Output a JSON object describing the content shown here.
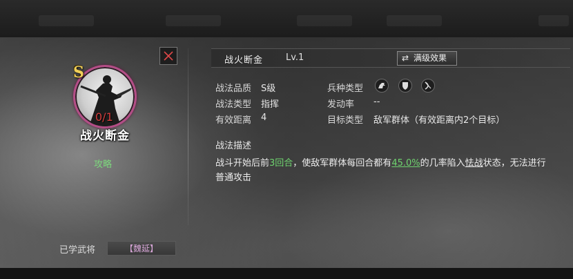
{
  "skill": {
    "grade_badge": "S",
    "level_count": "0/1",
    "name": "战火断金",
    "level": "Lv.1",
    "guide_link": "攻略",
    "max_level_button": "满级效果",
    "max_level_icon": "swap-arrows-icon"
  },
  "attributes": {
    "quality_label": "战法品质",
    "quality_value": "S级",
    "type_label": "战法类型",
    "type_value": "指挥",
    "range_label": "有效距离",
    "range_value": "4",
    "troop_label": "兵种类型",
    "troop_icons": [
      "cavalry-icon",
      "shield-icon",
      "bow-icon"
    ],
    "trigger_label": "发动率",
    "trigger_value": "--",
    "target_label": "目标类型",
    "target_value": "敌军群体（有效距离内2个目标）"
  },
  "description": {
    "title": "战法描述",
    "part1": "战斗开始后前",
    "rounds": "3回合",
    "part2": "，使敌军群体每回合都有",
    "rate": "45.0%",
    "part3": "的几率陷入",
    "status": "怯战",
    "part4": "状态，无法进行普通攻击"
  },
  "learned": {
    "label": "已学武将",
    "general": "【魏延】"
  },
  "colors": {
    "accent_green": "#6fd46f",
    "grade_gold": "#f1cf58",
    "count_red": "#d43c3c",
    "ring_purple": "#b34d86"
  }
}
